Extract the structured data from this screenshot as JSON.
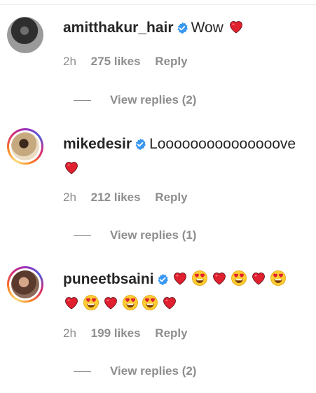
{
  "comments": [
    {
      "username": "amitthakur_hair",
      "text": "Wow",
      "emojis": [
        "heart"
      ],
      "time": "2h",
      "likes": "275 likes",
      "reply_label": "Reply",
      "view_replies": "View replies (2)"
    },
    {
      "username": "mikedesir",
      "text": "Looooooooooooooove",
      "emojis": [
        "heart"
      ],
      "time": "2h",
      "likes": "212 likes",
      "reply_label": "Reply",
      "view_replies": "View replies (1)"
    },
    {
      "username": "puneetbsaini",
      "text": "",
      "emojis": [
        "heart",
        "heart-eyes",
        "heart",
        "heart-eyes",
        "heart",
        "heart-eyes",
        "heart",
        "heart-eyes",
        "heart",
        "heart-eyes",
        "heart-eyes",
        "heart"
      ],
      "time": "2h",
      "likes": "199 likes",
      "reply_label": "Reply",
      "view_replies": "View replies (2)"
    }
  ],
  "colors": {
    "verified": "#3897f0",
    "meta": "#8e8e8e",
    "text": "#262626",
    "heart": "#e0202f"
  }
}
